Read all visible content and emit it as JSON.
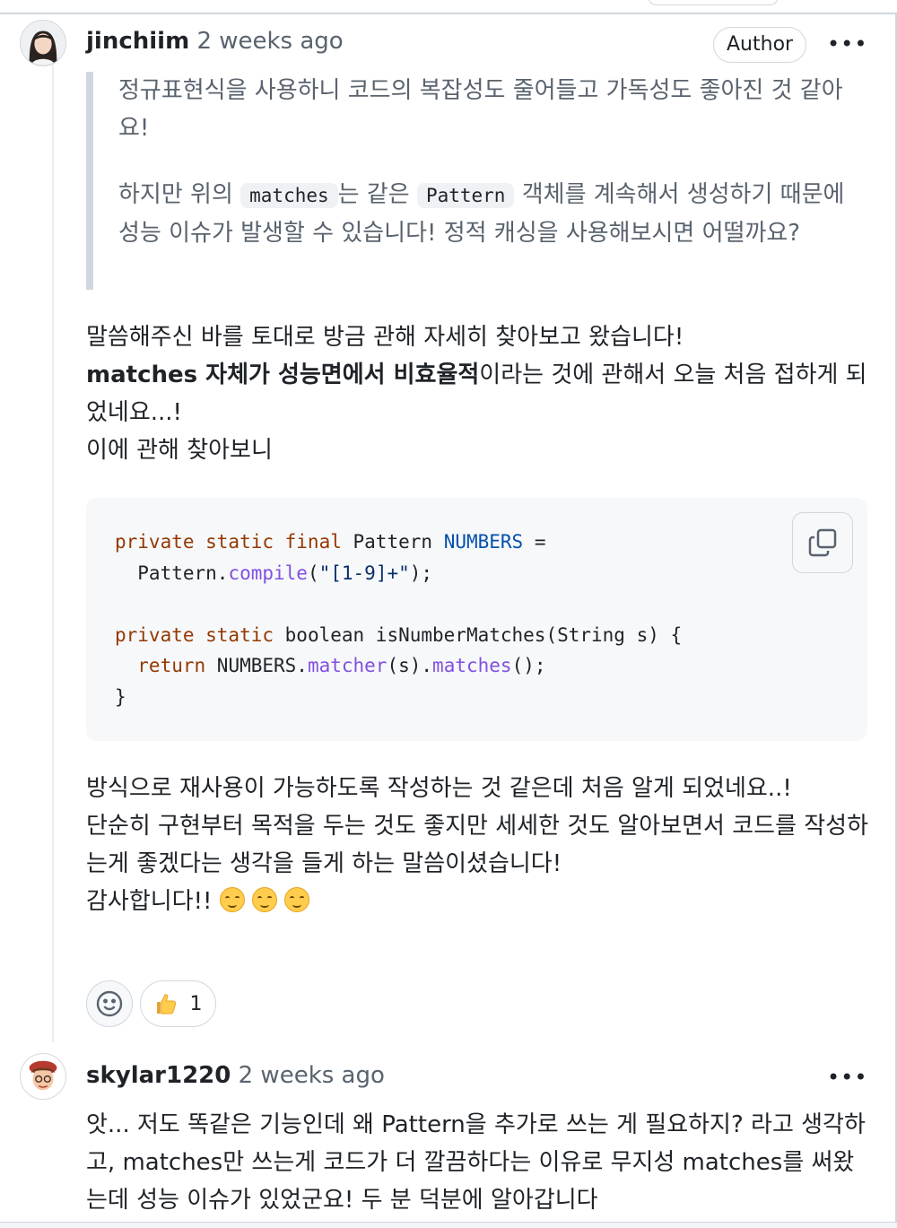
{
  "comment1": {
    "author": "jinchiim",
    "time": "2 weeks ago",
    "badge": "Author",
    "menu_icon": "kebab-horizontal-icon",
    "quote": {
      "p1": "정규표현식을 사용하니 코드의 복잡성도 줄어들고 가독성도 좋아진 것 같아요!",
      "p2_a": "하지만 위의 ",
      "p2_code1": "matches",
      "p2_b": "는 같은 ",
      "p2_code2": "Pattern",
      "p2_c": " 객체를 계속해서 생성하기 때문에 성능 이슈가 발생할 수 있습니다! 정적 캐싱을 사용해보시면 어떨까요?"
    },
    "para1": {
      "line1": "말씀해주신 바를 토대로 방금 관해 자세히 찾아보고 왔습니다!",
      "bold": "matches 자체가 성능면에서 비효율적",
      "rest": "이라는 것에 관해서 오늘 처음 접하게 되었네요...!",
      "line3": "이에 관해 찾아보니"
    },
    "code": {
      "l1_kw": "private static final",
      "l1_type": " Pattern",
      "l1_name": "NUMBERS",
      "l1_eq": " =",
      "l2_a": "  Pattern.",
      "l2_fn": "compile",
      "l2_b": "(",
      "l2_str": "\"[1-9]+\"",
      "l2_c": ");",
      "l4_kw": "private static",
      "l4_rest": " boolean isNumberMatches(String s) {",
      "l5_kw": "  return",
      "l5_a": " NUMBERS.",
      "l5_fn1": "matcher",
      "l5_b": "(s).",
      "l5_fn2": "matches",
      "l5_c": "();",
      "l6": "}",
      "copy_icon": "copy-icon"
    },
    "para2": {
      "line1": "방식으로 재사용이 가능하도록 작성하는 것 같은데 처음 알게 되었네요..!",
      "line2": "단순히 구현부터 목적을 두는 것도 좋지만 세세한 것도 알아보면서 코드를 작성하는게 좋겠다는 생각을 들게 하는 말씀이셨습니다!",
      "line3": "감사합니다!! "
    },
    "reactions": {
      "add_icon": "smiley-icon",
      "thumbs_up_icon": "thumbs-up-icon",
      "thumbs_up_count": "1"
    }
  },
  "comment2": {
    "author": "skylar1220",
    "time": "2 weeks ago",
    "menu_icon": "kebab-horizontal-icon",
    "body": "앗... 저도 똑같은 기능인데 왜 Pattern을 추가로 쓰는 게 필요하지? 라고 생각하고, matches만 쓰는게 코드가 더 깔끔하다는 이유로 무지성 matches를 써왔는데 성능 이슈가 있었군요! 두 분 덕분에 알아갑니다"
  }
}
